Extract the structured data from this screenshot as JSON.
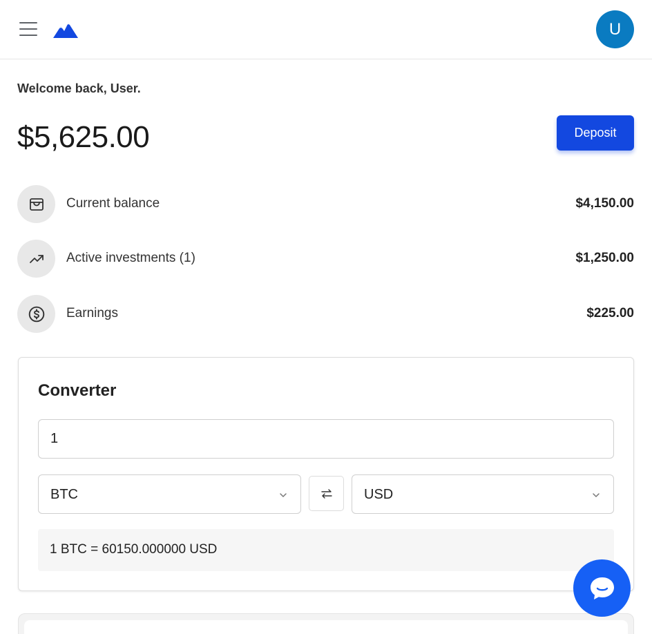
{
  "header": {
    "menu_icon": "hamburger-menu-icon",
    "logo_icon": "mountain-logo-icon",
    "avatar_initial": "U",
    "avatar_color": "#0a7bc1"
  },
  "main": {
    "welcome_text": "Welcome back, User.",
    "total_balance": "$5,625.00",
    "deposit_label": "Deposit",
    "stats": [
      {
        "icon": "wallet-icon",
        "label": "Current balance",
        "value": "$4,150.00"
      },
      {
        "icon": "trending-up-icon",
        "label": "Active investments (1)",
        "value": "$1,250.00"
      },
      {
        "icon": "dollar-circle-icon",
        "label": "Earnings",
        "value": "$225.00"
      }
    ]
  },
  "converter": {
    "title": "Converter",
    "amount": "1",
    "from_currency": "BTC",
    "to_currency": "USD",
    "swap_icon": "swap-arrows-icon",
    "result": "1 BTC = 60150.000000 USD"
  },
  "chat": {
    "icon": "chat-bubble-icon"
  },
  "colors": {
    "accent": "#1348e0",
    "chat": "#1660f5",
    "stat_icon_bg": "#e8e8e8"
  }
}
